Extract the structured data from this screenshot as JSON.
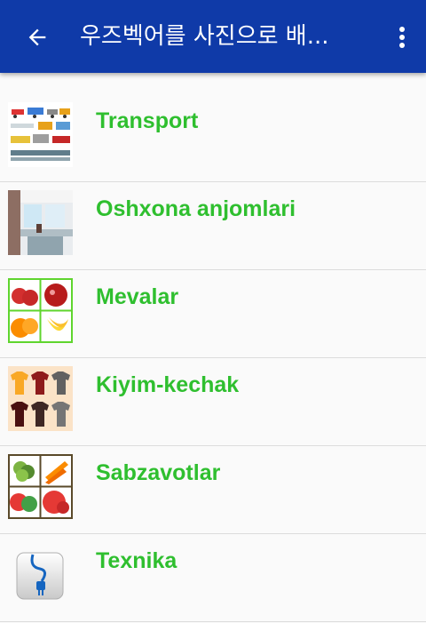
{
  "appbar": {
    "title": "우즈벡어를 사진으로 배...",
    "back_icon": "arrow-back-icon",
    "menu_icon": "more-vert-icon",
    "background_color": "#0f3aa8"
  },
  "categories": [
    {
      "label": "Transport",
      "icon": "transport-thumbnail"
    },
    {
      "label": "Oshxona anjomlari",
      "icon": "kitchen-thumbnail"
    },
    {
      "label": "Mevalar",
      "icon": "fruits-thumbnail"
    },
    {
      "label": "Kiyim-kechak",
      "icon": "clothes-thumbnail"
    },
    {
      "label": "Sabzavotlar",
      "icon": "vegetables-thumbnail"
    },
    {
      "label": "Texnika",
      "icon": "plug-thumbnail"
    }
  ],
  "colors": {
    "label": "#2fbf2f",
    "divider": "#dcdcdc"
  }
}
